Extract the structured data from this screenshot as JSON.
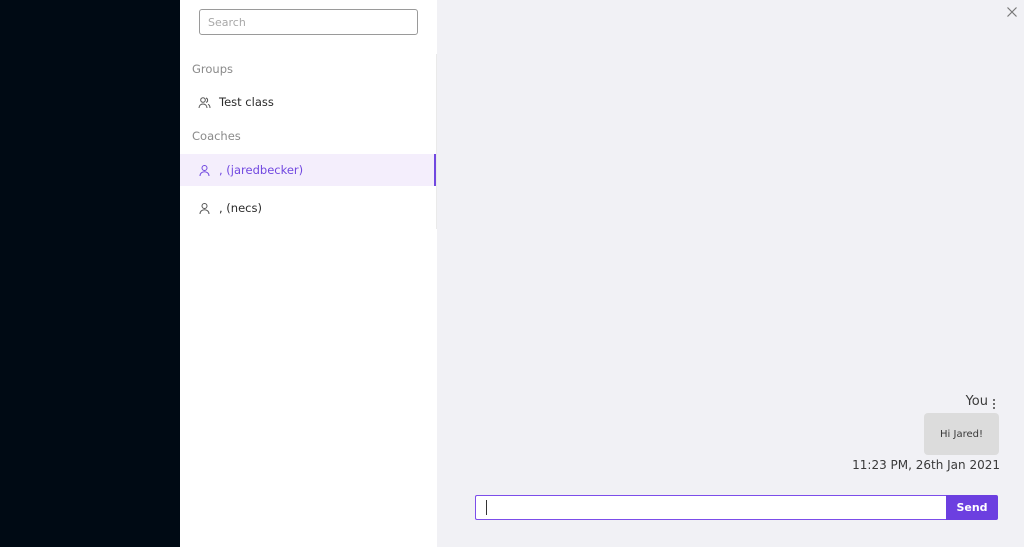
{
  "search": {
    "placeholder": "Search",
    "value": ""
  },
  "groups": {
    "title": "Groups",
    "items": [
      {
        "label": "Test class",
        "icon": "group-icon"
      }
    ]
  },
  "coaches": {
    "title": "Coaches",
    "items": [
      {
        "label": ", (jaredbecker)",
        "icon": "user-icon",
        "active": true
      },
      {
        "label": ", (necs)",
        "icon": "user-icon",
        "active": false
      }
    ]
  },
  "chat": {
    "close_icon": "close-icon",
    "messages": [
      {
        "sender": "You",
        "text": "Hi Jared!",
        "timestamp": "11:23 PM, 26th Jan 2021"
      }
    ],
    "input": {
      "placeholder": "",
      "value": ""
    },
    "send_label": "Send"
  },
  "colors": {
    "accent": "#6c3fe0",
    "active_bg": "#f4eefc",
    "chat_bg": "#f1f1f5",
    "dark_bg": "#000a14"
  }
}
